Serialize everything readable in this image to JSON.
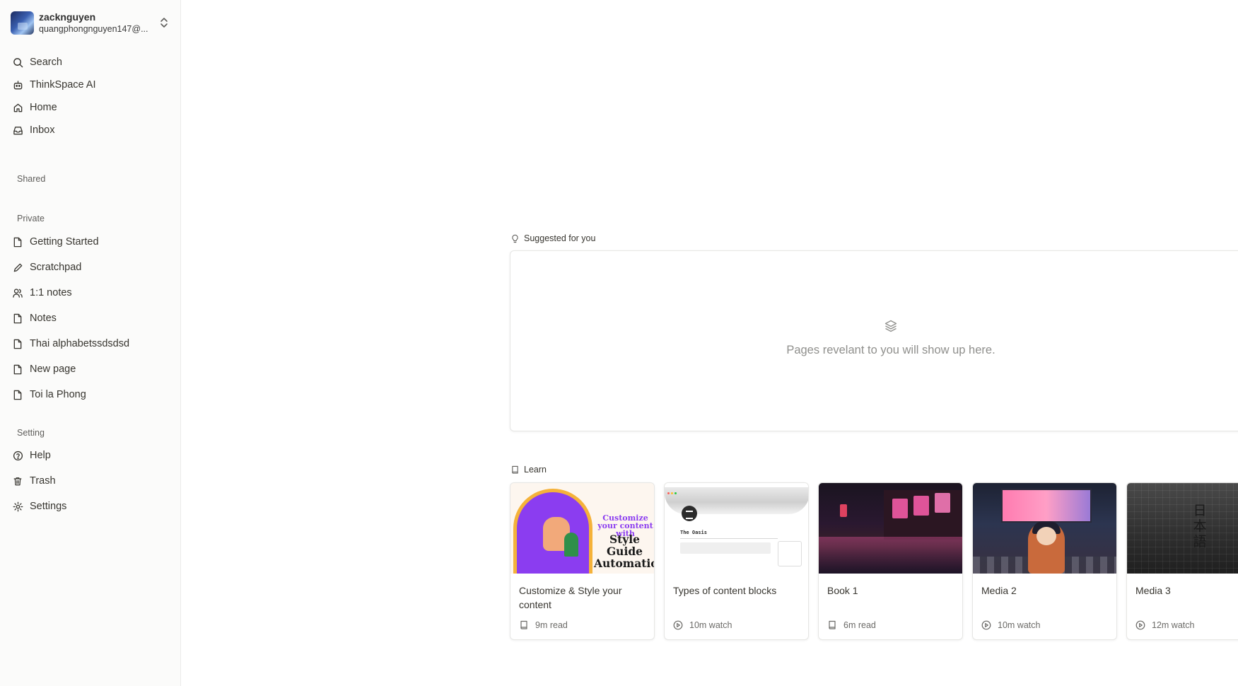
{
  "account": {
    "name": "zacknguyen",
    "email": "quangphongnguyen147@..."
  },
  "sidebar": {
    "top_items": [
      {
        "label": "Search",
        "icon": "search-icon"
      },
      {
        "label": "ThinkSpace AI",
        "icon": "robot-icon"
      },
      {
        "label": "Home",
        "icon": "home-icon"
      },
      {
        "label": "Inbox",
        "icon": "inbox-icon"
      }
    ],
    "shared_title": "Shared",
    "private_title": "Private",
    "private_items": [
      {
        "label": "Getting Started",
        "icon": "page-icon"
      },
      {
        "label": "Scratchpad",
        "icon": "pencil-icon"
      },
      {
        "label": "1:1 notes",
        "icon": "users-icon"
      },
      {
        "label": "Notes",
        "icon": "page-icon"
      },
      {
        "label": "Thai alphabetssdsdsd",
        "icon": "page-icon"
      },
      {
        "label": "New page",
        "icon": "page-icon"
      },
      {
        "label": "Toi la Phong",
        "icon": "page-icon"
      }
    ],
    "setting_title": "Setting",
    "setting_items": [
      {
        "label": "Help",
        "icon": "help-icon"
      },
      {
        "label": "Trash",
        "icon": "trash-icon"
      },
      {
        "label": "Settings",
        "icon": "gear-icon"
      }
    ]
  },
  "suggested": {
    "title": "Suggested for you",
    "empty_text": "Pages revelant to you will show up here."
  },
  "learn": {
    "title": "Learn",
    "cards": [
      {
        "title": "Customize & Style your content",
        "meta": "9m read",
        "meta_icon": "book-icon",
        "thumb_text_1": "Customize your content with",
        "thumb_text_2": "Style Guide Automation"
      },
      {
        "title": "Types of content blocks",
        "meta": "10m watch",
        "meta_icon": "play-icon",
        "thumb_text_1": "The Oasis"
      },
      {
        "title": "Book 1",
        "meta": "6m read",
        "meta_icon": "book-icon"
      },
      {
        "title": "Media 2",
        "meta": "10m watch",
        "meta_icon": "play-icon"
      },
      {
        "title": "Media 3",
        "meta": "12m watch",
        "meta_icon": "play-icon",
        "thumb_text_1": "日本語"
      }
    ]
  },
  "colors": {
    "sidebar_bg": "#fbfbfa",
    "text": "#37352f",
    "muted": "#8f8f8c",
    "border": "#e6e6e4"
  }
}
